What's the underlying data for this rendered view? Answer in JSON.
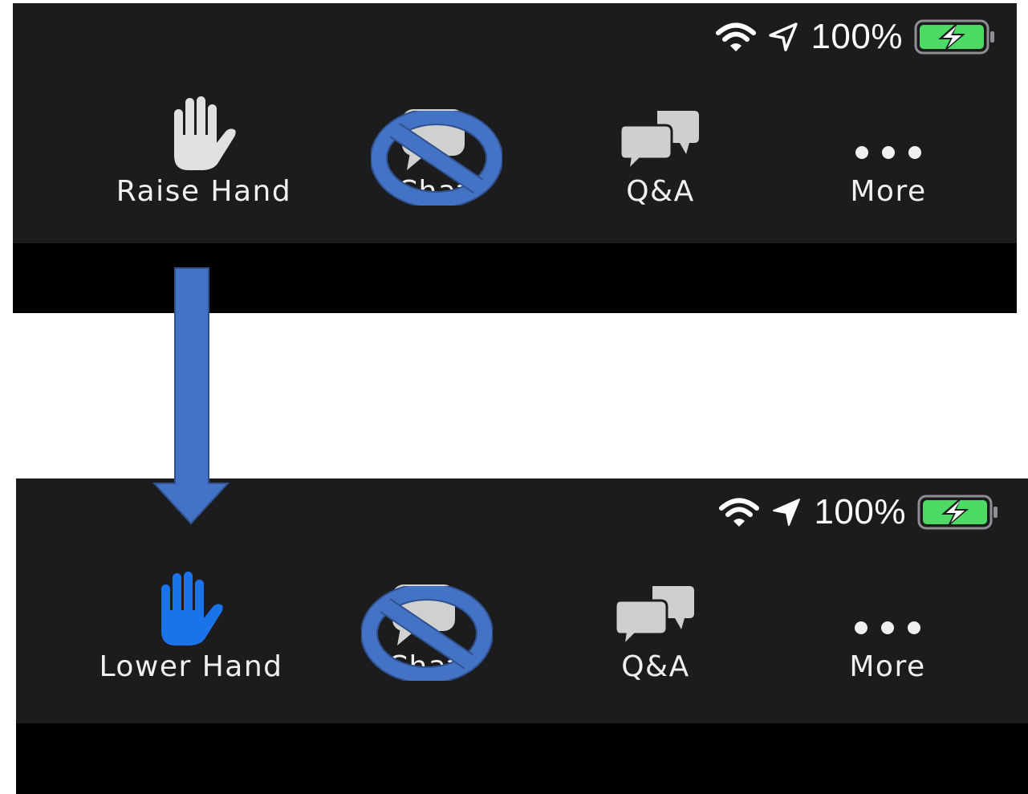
{
  "top_toolbar": {
    "status": {
      "battery_pct": "100%",
      "battery_level": 1.0,
      "charging": true,
      "location_icon_style": "outline"
    },
    "buttons": [
      {
        "id": "raise-hand",
        "label": "Raise Hand",
        "icon": "hand-icon",
        "icon_color": "#e0e0e0"
      },
      {
        "id": "chat",
        "label": "Chat",
        "icon": "chat-bubble-icon",
        "icon_color": "#d0d0d0",
        "blocked": true
      },
      {
        "id": "qa",
        "label": "Q&A",
        "icon": "qa-bubbles-icon",
        "icon_color": "#cfcfcf"
      },
      {
        "id": "more",
        "label": "More",
        "icon": "ellipsis-icon",
        "icon_color": "#f0f0f0"
      }
    ]
  },
  "bottom_toolbar": {
    "status": {
      "battery_pct": "100%",
      "battery_level": 1.0,
      "charging": true,
      "location_icon_style": "filled"
    },
    "buttons": [
      {
        "id": "lower-hand",
        "label": "Lower Hand",
        "icon": "hand-icon",
        "icon_color": "#1a73e8"
      },
      {
        "id": "chat",
        "label": "Chat",
        "icon": "chat-bubble-icon",
        "icon_color": "#d0d0d0",
        "blocked": true
      },
      {
        "id": "qa",
        "label": "Q&A",
        "icon": "qa-bubbles-icon",
        "icon_color": "#cfcfcf"
      },
      {
        "id": "more",
        "label": "More",
        "icon": "ellipsis-icon",
        "icon_color": "#f0f0f0"
      }
    ]
  },
  "annotations": {
    "block_symbol_color": "#4472c4",
    "arrow_color": "#4472c4",
    "arrow_direction": "down"
  },
  "colors": {
    "toolbar_bg": "#1c1c1e",
    "panel_bg": "#000000",
    "page_bg": "#ffffff",
    "battery_green": "#4cd964"
  }
}
